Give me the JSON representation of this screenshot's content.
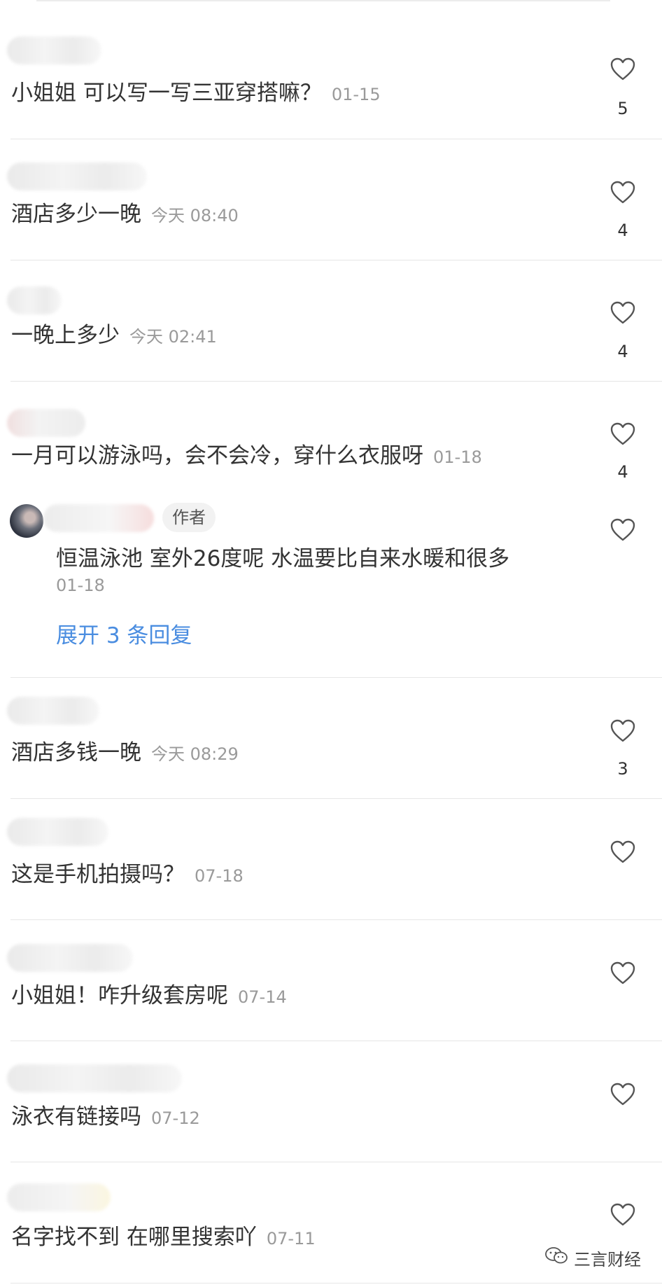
{
  "comments": [
    {
      "text": "小姐姐 可以写一写三亚穿搭嘛？",
      "time": "01-15",
      "likes": "5"
    },
    {
      "text": "酒店多少一晚",
      "time": "今天 08:40",
      "likes": "4"
    },
    {
      "text": "一晚上多少",
      "time": "今天 02:41",
      "likes": "4"
    },
    {
      "text": "一月可以游泳吗，会不会冷，穿什么衣服呀",
      "time": "01-18",
      "likes": "4"
    },
    {
      "text": "酒店多钱一晚",
      "time": "今天 08:29",
      "likes": "3"
    },
    {
      "text": "这是手机拍摄吗？",
      "time": "07-18",
      "likes": ""
    },
    {
      "text": "小姐姐！咋升级套房呢",
      "time": "07-14",
      "likes": ""
    },
    {
      "text": "泳衣有链接吗",
      "time": "07-12",
      "likes": ""
    },
    {
      "text": "名字找不到 在哪里搜索吖",
      "time": "07-11",
      "likes": ""
    }
  ],
  "reply": {
    "badge": "作者",
    "text": "恒温泳池 室外26度呢 水温要比自来水暖和很多",
    "time": "01-18",
    "expand": "展开 3 条回复"
  },
  "watermark": {
    "text": "三言财经",
    "icon": "wechat-icon"
  }
}
